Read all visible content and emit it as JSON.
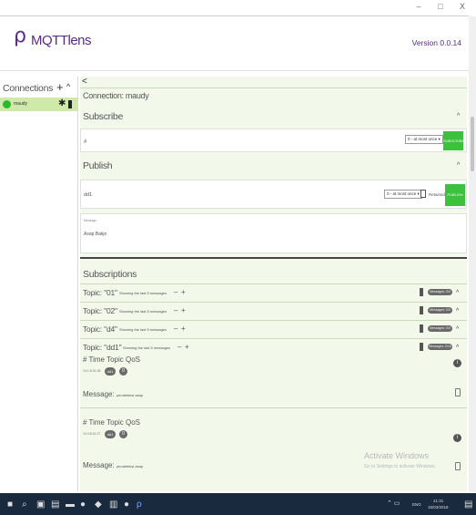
{
  "window": {
    "controls": "– □ X"
  },
  "header": {
    "logo_glyph": "ρ",
    "title": "MQTTlens",
    "version": "Version 0.0.14"
  },
  "sidebar": {
    "title": "Connections",
    "add_label": "+",
    "collapse_label": "^",
    "connection": {
      "name": "maudy",
      "status_color": "#2eb82e"
    }
  },
  "main": {
    "back_label": "<",
    "connection_label": "Connection: maudy",
    "subscribe": {
      "title": "Subscribe",
      "topic_value": "#",
      "qos": "0 - at most once ▾",
      "button": "SUBSCRIBE"
    },
    "publish": {
      "title": "Publish",
      "topic_value": "dd1",
      "qos": "0 - at most once ▾",
      "retained_label": "Retained",
      "button": "PUBLISH",
      "message_label": "Message",
      "message_value": "Asap Bakjo"
    },
    "subscriptions": {
      "title": "Subscriptions",
      "topics": [
        {
          "name": "Topic: \"01\"",
          "showing": "Showing the last 5 messages",
          "badge": "Messages: 0/0"
        },
        {
          "name": "Topic: \"02\"",
          "showing": "Showing the last 5 messages",
          "badge": "Messages: 0/0"
        },
        {
          "name": "Topic: \"d4\"",
          "showing": "Showing the last 5 messages",
          "badge": "Messages: 0/0"
        },
        {
          "name": "Topic: \"dd1\"",
          "showing": "Showing the last 5 messages",
          "badge": "Messages: 2/16"
        }
      ],
      "messages": [
        {
          "heading": "# Time Topic QoS",
          "timestamp": "19:1:8:31:08",
          "topic": "dd1",
          "qos": "0",
          "label": "Message:",
          "value": "pendeteksi asap"
        },
        {
          "heading": "# Time Topic QoS",
          "timestamp": "19:2:8:31:07",
          "topic": "dd1",
          "qos": "0",
          "label": "Message:",
          "value": "pendeteksi asap"
        }
      ]
    }
  },
  "overlay": {
    "activate_title": "Activate Windows",
    "activate_sub": "Go to Settings to activate Windows."
  },
  "taskbar": {
    "lang": "ENG",
    "time": "21:31",
    "date": "15/03/2018"
  },
  "colors": {
    "brand": "#5a2a8a",
    "accent_green": "#3cc13c",
    "panel_bg": "#f3f9ea",
    "selected_bg": "#cfe9a8",
    "taskbar": "#1a2a3e"
  }
}
